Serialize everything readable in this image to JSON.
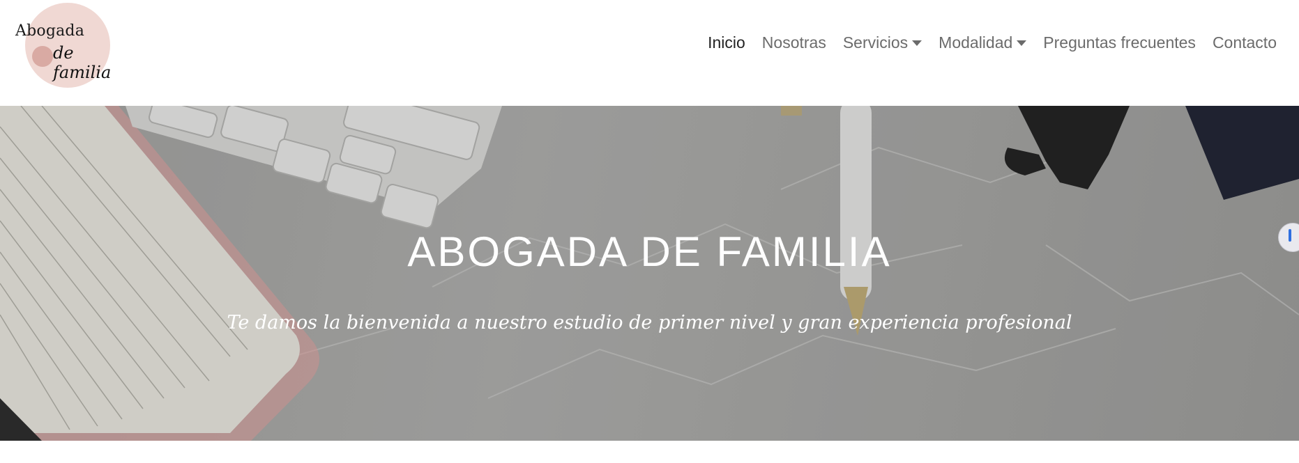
{
  "brand": {
    "line1": "Abogada",
    "line2": "de familia",
    "circle_color": "#f0d8d3",
    "accent_color": "#d9aaa3"
  },
  "nav": {
    "items": [
      {
        "label": "Inicio",
        "active": true,
        "dropdown": false
      },
      {
        "label": "Nosotras",
        "active": false,
        "dropdown": false
      },
      {
        "label": "Servicios",
        "active": false,
        "dropdown": true
      },
      {
        "label": "Modalidad",
        "active": false,
        "dropdown": true
      },
      {
        "label": "Preguntas frecuentes",
        "active": false,
        "dropdown": false
      },
      {
        "label": "Contacto",
        "active": false,
        "dropdown": false
      }
    ]
  },
  "hero": {
    "title": "ABOGADA DE FAMILIA",
    "subtitle": "Te damos la bienvenida a nuestro estudio de primer nivel y gran experiencia profesional",
    "background": "marble desk with notebook, keyboard, pen and glasses",
    "text_color": "#ffffff"
  },
  "side_handle": {
    "icon": "accessibility-handle-icon",
    "color": "#2f6fe0"
  }
}
